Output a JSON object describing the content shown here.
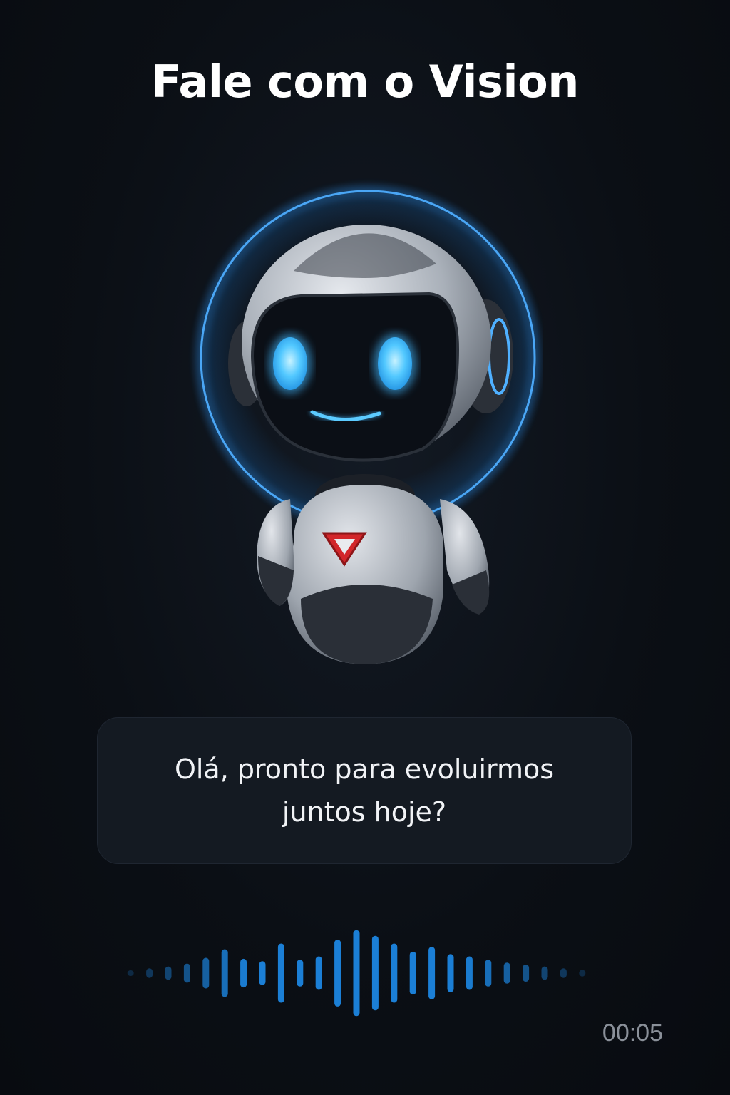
{
  "header": {
    "title": "Fale com o Vision"
  },
  "assistant": {
    "name": "Vision",
    "avatar_icon": "robot-icon",
    "glow_color": "#3a9cf0",
    "emblem_color": "#d2262a"
  },
  "message": {
    "text": "Olá, pronto para evoluirmos juntos hoje?"
  },
  "voice": {
    "waveform_icon": "waveform-icon",
    "color": "#1b7fd6",
    "levels": [
      0.06,
      0.1,
      0.14,
      0.2,
      0.32,
      0.5,
      0.3,
      0.25,
      0.62,
      0.28,
      0.35,
      0.7,
      0.9,
      0.78,
      0.62,
      0.45,
      0.55,
      0.4,
      0.35,
      0.28,
      0.22,
      0.18,
      0.14,
      0.1,
      0.07
    ]
  },
  "status": {
    "elapsed": "00:05"
  }
}
